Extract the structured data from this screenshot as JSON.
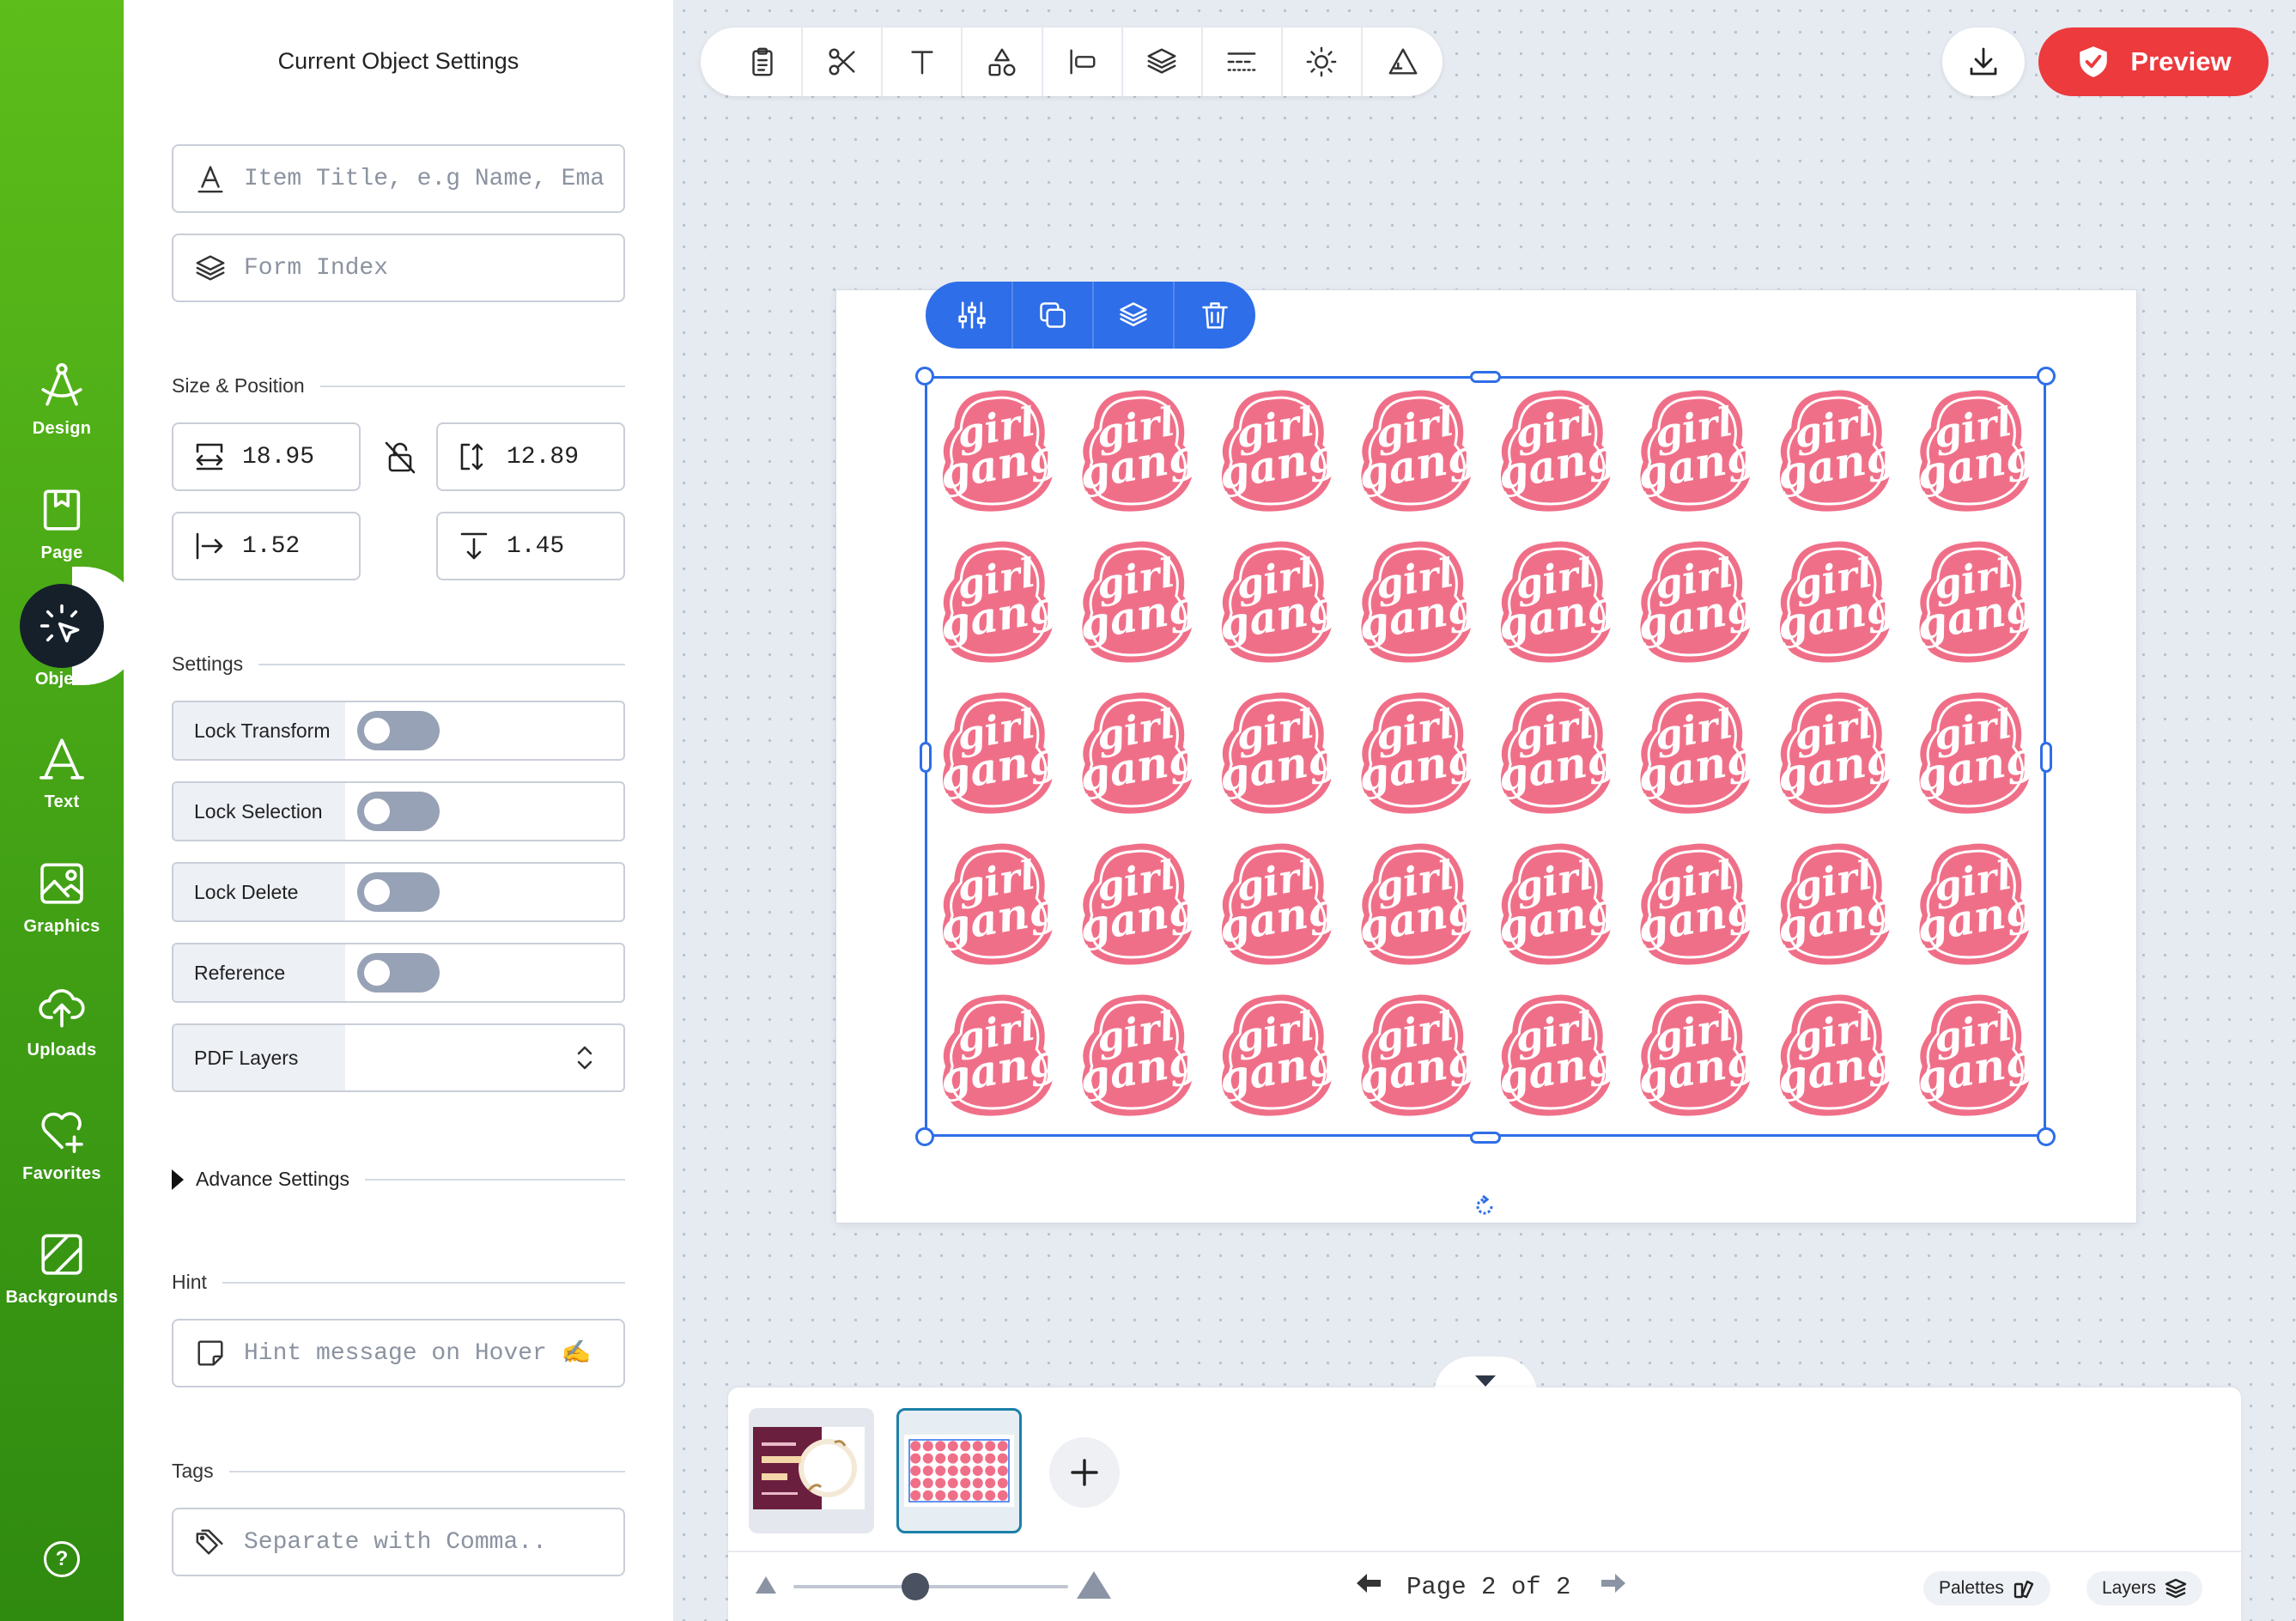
{
  "rail": {
    "items": [
      {
        "label": "Design",
        "icon": "compass-icon"
      },
      {
        "label": "Page",
        "icon": "page-icon"
      },
      {
        "label": "Object",
        "icon": "cursor-click-icon",
        "active": true
      },
      {
        "label": "Text",
        "icon": "text-a-icon"
      },
      {
        "label": "Graphics",
        "icon": "image-icon"
      },
      {
        "label": "Uploads",
        "icon": "cloud-upload-icon"
      },
      {
        "label": "Favorites",
        "icon": "heart-plus-icon"
      },
      {
        "label": "Backgrounds",
        "icon": "background-icon"
      }
    ],
    "help": "?"
  },
  "panel": {
    "title": "Current Object Settings",
    "item_title_placeholder": "Item Title, e.g Name, Email",
    "form_index_placeholder": "Form Index",
    "size_position_label": "Size & Position",
    "width": "18.95",
    "height": "12.89",
    "x": "1.52",
    "y": "1.45",
    "settings_label": "Settings",
    "toggles": [
      {
        "label": "Lock Transform",
        "on": false
      },
      {
        "label": "Lock Selection",
        "on": false
      },
      {
        "label": "Lock Delete",
        "on": false
      },
      {
        "label": "Reference",
        "on": false
      }
    ],
    "pdf_layers_label": "PDF Layers",
    "advance_settings_label": "Advance Settings",
    "hint_label": "Hint",
    "hint_placeholder": "Hint message on Hover ✍️",
    "tags_label": "Tags",
    "tags_placeholder": "Separate with Comma.."
  },
  "toolbar": {
    "icons": [
      "clipboard-icon",
      "scissors-icon",
      "text-tool-icon",
      "shapes-icon",
      "align-left-icon",
      "layers-icon",
      "line-style-icon",
      "brightness-icon",
      "triangle-ruler-icon"
    ],
    "preview_label": "Preview",
    "download_icon": "download-icon"
  },
  "object_toolbar": {
    "icons": [
      "adjustments-icon",
      "duplicate-icon",
      "layers-icon",
      "trash-icon"
    ]
  },
  "canvas": {
    "sticker_text_top": "girl",
    "sticker_text_bottom": "gang",
    "sticker_color": "#f06f88",
    "grid_cols": 8,
    "grid_rows": 5
  },
  "bottom": {
    "page_text": "Page 2 of 2",
    "palettes_label": "Palettes",
    "layers_label": "Layers",
    "zoom_level": 0.42
  },
  "colors": {
    "rail_green": "#4aad18",
    "accent_blue": "#2e6ee8",
    "preview_red": "#ec3a3d"
  }
}
